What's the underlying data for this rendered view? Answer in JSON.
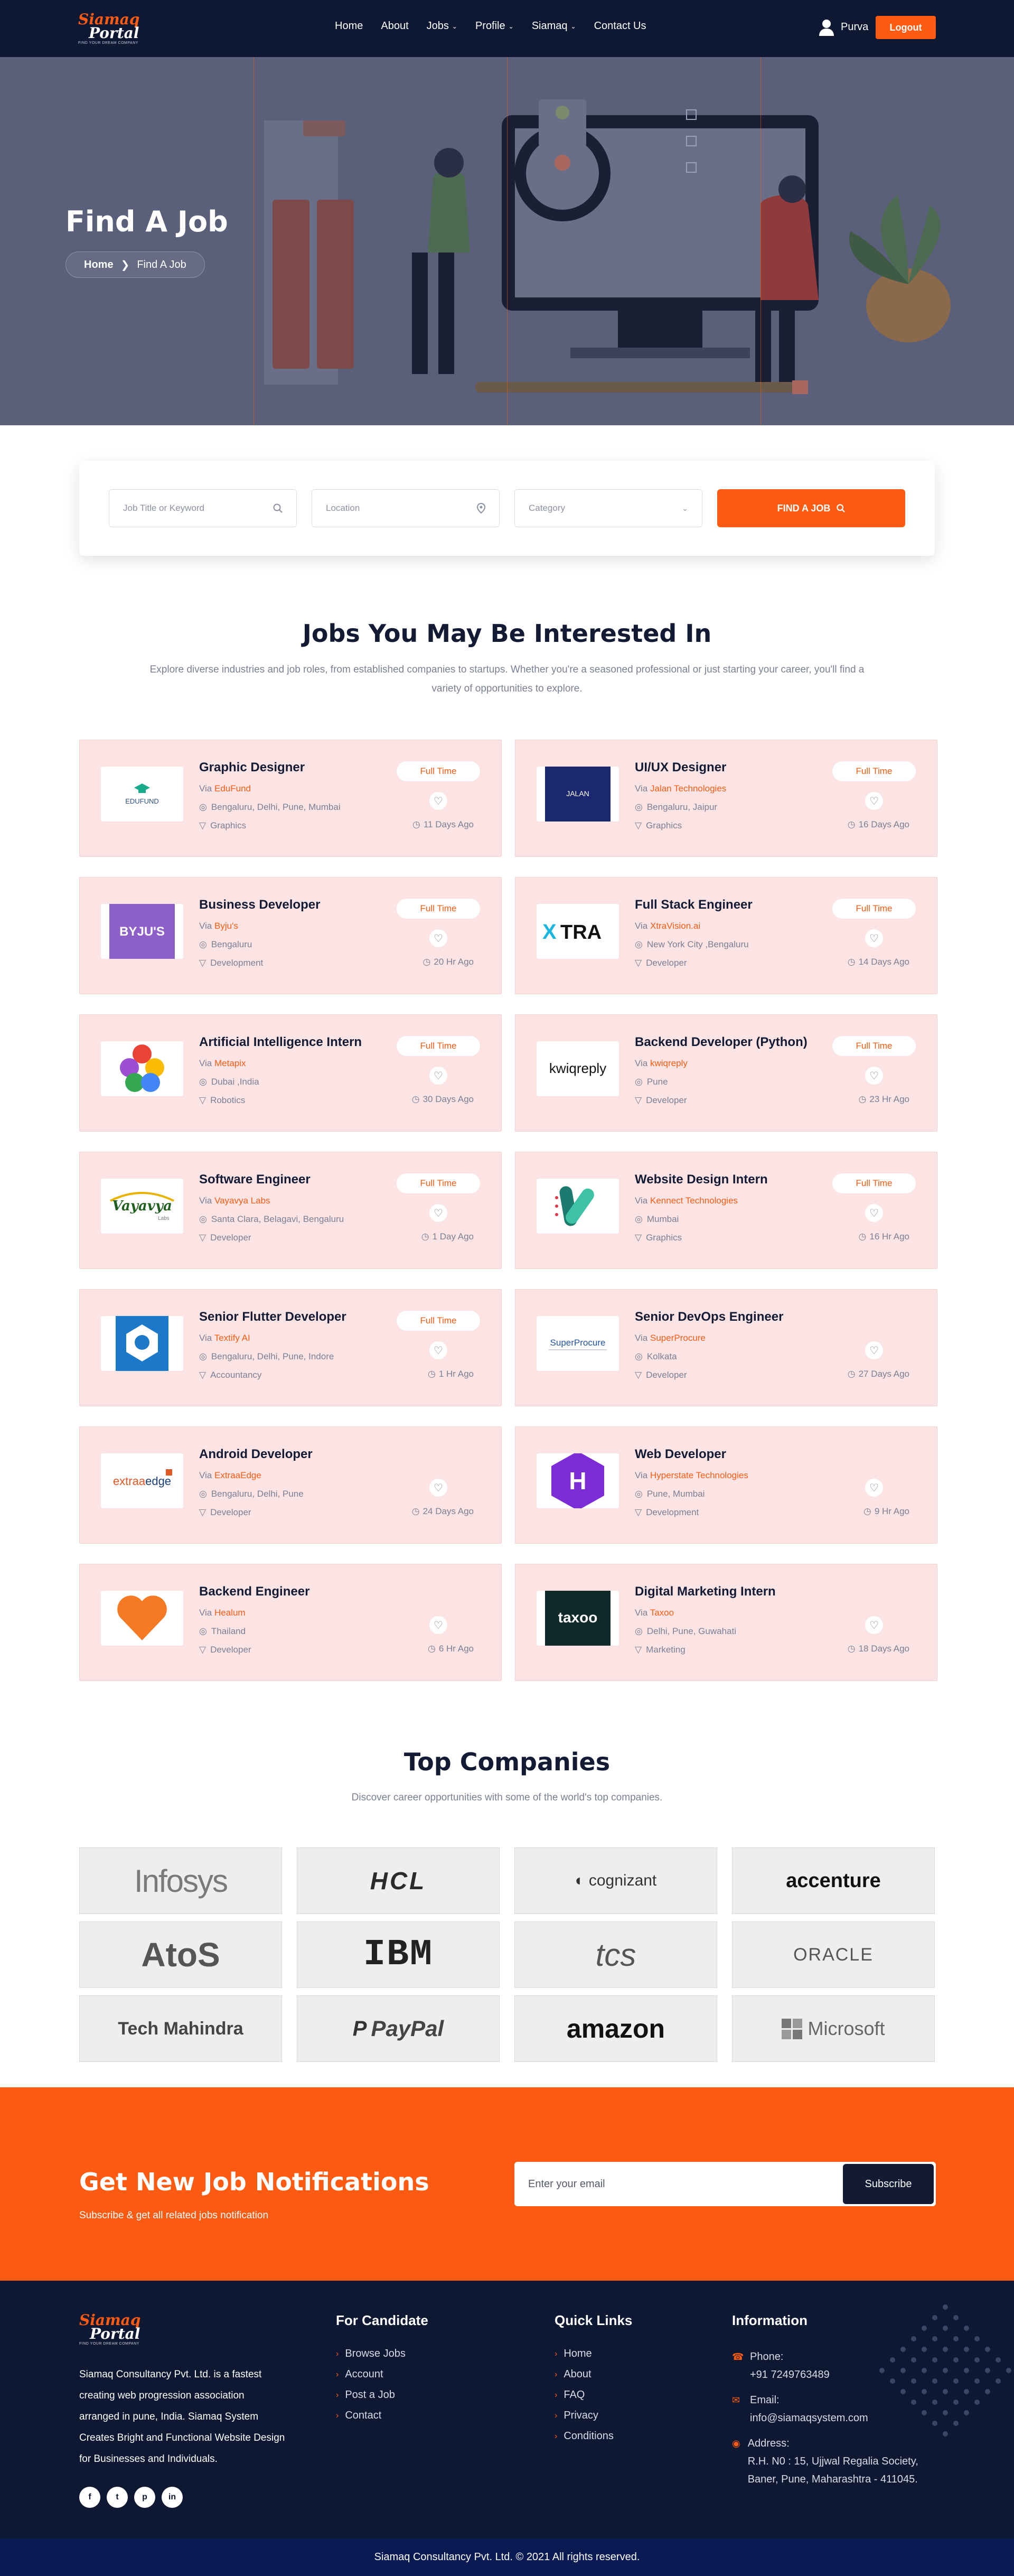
{
  "nav": {
    "logo_top": "Siamaq",
    "logo_bottom": "Portal",
    "logo_tag": "FIND YOUR DREAM COMPANY",
    "items": [
      {
        "label": "Home",
        "dropdown": false
      },
      {
        "label": "About",
        "dropdown": false
      },
      {
        "label": "Jobs",
        "dropdown": true
      },
      {
        "label": "Profile",
        "dropdown": true
      },
      {
        "label": "Siamaq",
        "dropdown": true
      },
      {
        "label": "Contact Us",
        "dropdown": false
      }
    ],
    "user_name": "Purva",
    "logout_label": "Logout"
  },
  "hero": {
    "title": "Find A Job",
    "crumb_home": "Home",
    "crumb_current": "Find A Job"
  },
  "search": {
    "keyword_placeholder": "Job Title or Keyword",
    "location_placeholder": "Location",
    "category_placeholder": "Category",
    "button_label": "FIND A JOB"
  },
  "jobs_section": {
    "title": "Jobs You May Be Interested In",
    "subtitle": "Explore diverse industries and job roles, from established companies to startups. Whether you're a seasoned professional or just starting your career, you'll find a variety of opportunities to explore."
  },
  "jobs": [
    {
      "title": "Graphic Designer",
      "via_prefix": "Via",
      "company": "EduFund",
      "location": "Bengaluru, Delhi, Pune, Mumbai",
      "category": "Graphics",
      "type": "Full Time",
      "posted": "11 Days Ago",
      "logo": "EDUFUND"
    },
    {
      "title": "UI/UX Designer",
      "via_prefix": "Via",
      "company": "Jalan Technologies",
      "location": "Bengaluru, Jaipur",
      "category": "Graphics",
      "type": "Full Time",
      "posted": "16 Days Ago",
      "logo": "JALAN"
    },
    {
      "title": "Business Developer",
      "via_prefix": "Via",
      "company": "Byju's",
      "location": "Bengaluru",
      "category": "Development",
      "type": "Full Time",
      "posted": "20 Hr Ago",
      "logo": "BYJU'S"
    },
    {
      "title": "Full Stack Engineer",
      "via_prefix": "Via",
      "company": "XtraVision.ai",
      "location": "New York City ,Bengaluru",
      "category": "Developer",
      "type": "Full Time",
      "posted": "14 Days Ago",
      "logo": "XTRA"
    },
    {
      "title": "Artificial Intelligence Intern",
      "via_prefix": "Via",
      "company": "Metapix",
      "location": "Dubai ,India",
      "category": "Robotics",
      "type": "Full Time",
      "posted": "30 Days Ago",
      "logo": ""
    },
    {
      "title": "Backend Developer (Python)",
      "via_prefix": "Via",
      "company": "kwiqreply",
      "location": "Pune",
      "category": "Developer",
      "type": "Full Time",
      "posted": "23 Hr Ago",
      "logo": "kwiqreply"
    },
    {
      "title": "Software Engineer",
      "via_prefix": "Via",
      "company": "Vayavya Labs",
      "location": "Santa Clara, Belagavi, Bengaluru",
      "category": "Developer",
      "type": "Full Time",
      "posted": "1 Day Ago",
      "logo": "Vayavya"
    },
    {
      "title": "Website Design Intern",
      "via_prefix": "Via",
      "company": "Kennect Technologies",
      "location": "Mumbai",
      "category": "Graphics",
      "type": "Full Time",
      "posted": "16 Hr Ago",
      "logo": ""
    },
    {
      "title": "Senior Flutter Developer",
      "via_prefix": "Via",
      "company": "Textify AI",
      "location": "Bengaluru, Delhi, Pune, Indore",
      "category": "Accountancy",
      "type": "Full Time",
      "posted": "1 Hr Ago",
      "logo": ""
    },
    {
      "title": "Senior DevOps Engineer",
      "via_prefix": "Via",
      "company": "SuperProcure",
      "location": "Kolkata",
      "category": "Developer",
      "type": "",
      "posted": "27 Days Ago",
      "logo": "SuperProcure"
    },
    {
      "title": "Android Developer",
      "via_prefix": "Via",
      "company": "ExtraaEdge",
      "location": "Bengaluru, Delhi, Pune",
      "category": "Developer",
      "type": "",
      "posted": "24 Days Ago",
      "logo": "extraaedge"
    },
    {
      "title": "Web Developer",
      "via_prefix": "Via",
      "company": "Hyperstate Technologies",
      "location": "Pune, Mumbai",
      "category": "Development",
      "type": "",
      "posted": "9 Hr Ago",
      "logo": ""
    },
    {
      "title": "Backend Engineer",
      "via_prefix": "Via",
      "company": "Healum",
      "location": "Thailand",
      "category": "Developer",
      "type": "",
      "posted": "6 Hr Ago",
      "logo": ""
    },
    {
      "title": "Digital Marketing Intern",
      "via_prefix": "Via",
      "company": "Taxoo",
      "location": "Delhi, Pune, Guwahati",
      "category": "Marketing",
      "type": "",
      "posted": "18 Days Ago",
      "logo": "taxoo"
    }
  ],
  "companies_section": {
    "title": "Top Companies",
    "subtitle": "Discover career opportunities with some of the world's top companies."
  },
  "companies": [
    "Infosys",
    "HCL",
    "cognizant",
    "accenture",
    "AtoS",
    "IBM",
    "tcs",
    "ORACLE",
    "Tech Mahindra",
    "PayPal",
    "amazon",
    "Microsoft"
  ],
  "newsletter": {
    "title": "Get New Job Notifications",
    "subtitle": "Subscribe & get all related jobs notification",
    "email_placeholder": "Enter your email",
    "button_label": "Subscribe"
  },
  "footer": {
    "about": "Siamaq Consultancy Pvt. Ltd. is a fastest creating web progression association arranged in pune, India. Siamaq System Creates Bright and Functional Website Design for Businesses and Individuals.",
    "candidate_title": "For Candidate",
    "candidate_links": [
      "Browse Jobs",
      "Account",
      "Post a Job",
      "Contact"
    ],
    "quick_title": "Quick Links",
    "quick_links": [
      "Home",
      "About",
      "FAQ",
      "Privacy",
      "Conditions"
    ],
    "info_title": "Information",
    "phone_label": "Phone:",
    "phone": "+91 7249763489",
    "email_label": "Email:",
    "email": "info@siamaqsystem.com",
    "address_label": "Address:",
    "address": "R.H. N0 : 15, Ujjwal Regalia Society, Baner, Pune, Maharashtra - 411045.",
    "social": [
      "facebook-icon",
      "twitter-icon",
      "pinterest-icon",
      "linkedin-icon"
    ],
    "copyright": "Siamaq Consultancy Pvt. Ltd. © 2021 All rights reserved."
  },
  "colors": {
    "accent": "#fe5b12",
    "navy": "#0e1833",
    "card_bg": "#fde4e4"
  }
}
